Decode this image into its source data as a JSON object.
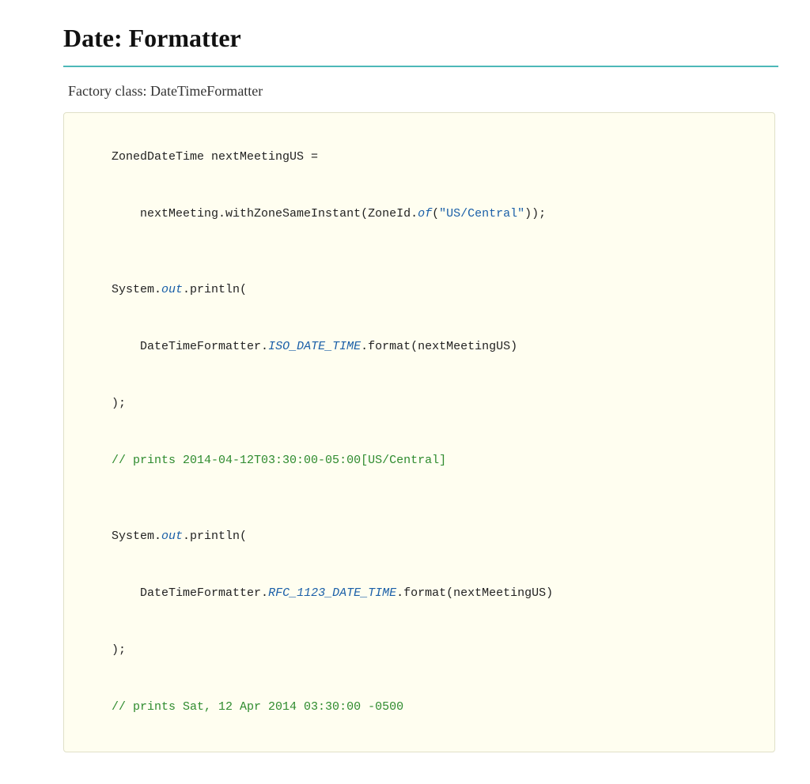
{
  "page": {
    "title": "Date: Formatter",
    "factory_label": "Factory class: DateTimeFormatter"
  },
  "code": {
    "lines": [
      {
        "type": "default",
        "segments": [
          {
            "text": "ZonedDateTime nextMeetingUS =",
            "style": "default"
          }
        ]
      },
      {
        "type": "default",
        "segments": [
          {
            "text": "    nextMeeting.withZoneSameInstant(ZoneId.",
            "style": "default"
          },
          {
            "text": "of",
            "style": "italic-blue"
          },
          {
            "text": "(",
            "style": "default"
          },
          {
            "text": "\"US/Central\"",
            "style": "string"
          },
          {
            "text": "));",
            "style": "default"
          }
        ]
      },
      {
        "type": "blank"
      },
      {
        "type": "default",
        "segments": [
          {
            "text": "System.",
            "style": "default"
          },
          {
            "text": "out",
            "style": "italic-blue"
          },
          {
            "text": ".println(",
            "style": "default"
          }
        ]
      },
      {
        "type": "default",
        "segments": [
          {
            "text": "    DateTimeFormatter.",
            "style": "default"
          },
          {
            "text": "ISO_DATE_TIME",
            "style": "italic-blue"
          },
          {
            "text": ".format(nextMeetingUS)",
            "style": "default"
          }
        ]
      },
      {
        "type": "default",
        "segments": [
          {
            "text": ");",
            "style": "default"
          }
        ]
      },
      {
        "type": "comment",
        "text": "// prints 2014-04-12T03:30:00-05:00[US/Central]"
      },
      {
        "type": "blank"
      },
      {
        "type": "default",
        "segments": [
          {
            "text": "System.",
            "style": "default"
          },
          {
            "text": "out",
            "style": "italic-blue"
          },
          {
            "text": ".println(",
            "style": "default"
          }
        ]
      },
      {
        "type": "default",
        "segments": [
          {
            "text": "    DateTimeFormatter.",
            "style": "default"
          },
          {
            "text": "RFC_1123_DATE_TIME",
            "style": "italic-blue"
          },
          {
            "text": ".format(nextMeetingUS)",
            "style": "default"
          }
        ]
      },
      {
        "type": "default",
        "segments": [
          {
            "text": ");",
            "style": "default"
          }
        ]
      },
      {
        "type": "comment",
        "text": "// prints Sat, 12 Apr 2014 03:30:00 -0500"
      }
    ]
  }
}
